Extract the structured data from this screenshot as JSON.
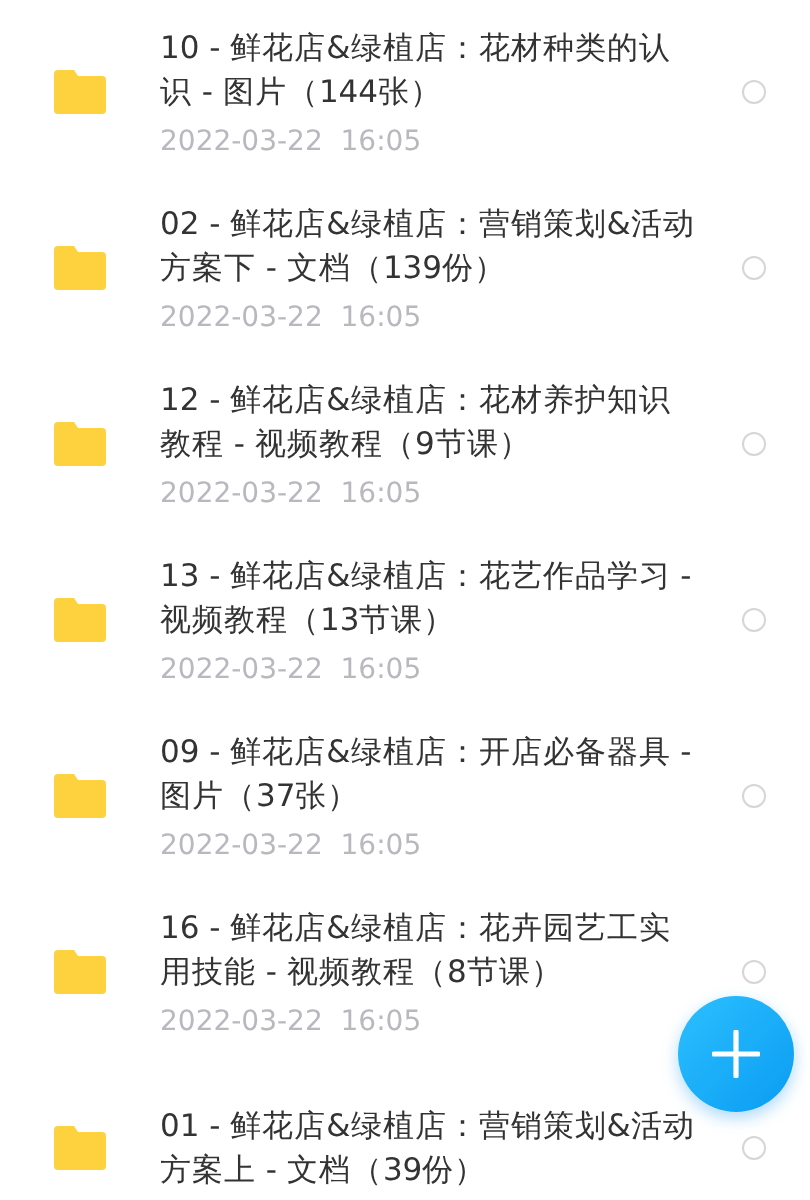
{
  "files": [
    {
      "title": "10 - 鲜花店&绿植店：花材种类的认识 - 图片（144张）",
      "date": "2022-03-22  16:05",
      "selected": false
    },
    {
      "title": "02 - 鲜花店&绿植店：营销策划&活动方案下 - 文档（139份）",
      "date": "2022-03-22  16:05",
      "selected": false
    },
    {
      "title": "12 - 鲜花店&绿植店：花材养护知识教程 - 视频教程（9节课）",
      "date": "2022-03-22  16:05",
      "selected": false
    },
    {
      "title": "13 - 鲜花店&绿植店：花艺作品学习 - 视频教程（13节课）",
      "date": "2022-03-22  16:05",
      "selected": false
    },
    {
      "title": "09 - 鲜花店&绿植店：开店必备器具 - 图片（37张）",
      "date": "2022-03-22  16:05",
      "selected": false
    },
    {
      "title": "16 - 鲜花店&绿植店：花卉园艺工实用技能 - 视频教程（8节课）",
      "date": "2022-03-22  16:05",
      "selected": false
    },
    {
      "title": "01 - 鲜花店&绿植店：营销策划&活动方案上 - 文档（39份）",
      "selected": false
    }
  ]
}
